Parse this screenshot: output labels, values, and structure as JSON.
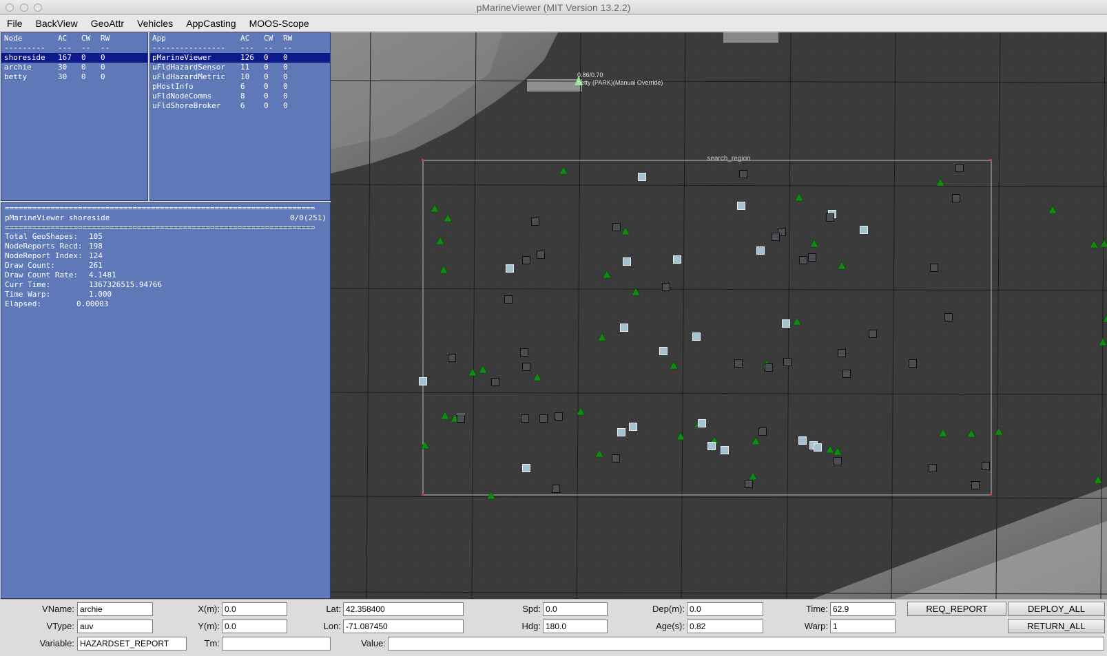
{
  "window": {
    "title": "pMarineViewer (MIT Version 13.2.2)"
  },
  "menu": [
    "File",
    "BackView",
    "GeoAttr",
    "Vehicles",
    "AppCasting",
    "MOOS-Scope"
  ],
  "nodes": {
    "headers": [
      "Node",
      "AC",
      "CW",
      "RW"
    ],
    "separator": [
      "---------",
      "---",
      "--",
      "--"
    ],
    "rows": [
      {
        "name": "shoreside",
        "ac": "167",
        "cw": "0",
        "rw": "0",
        "selected": true
      },
      {
        "name": "archie",
        "ac": "30",
        "cw": "0",
        "rw": "0"
      },
      {
        "name": "betty",
        "ac": "30",
        "cw": "0",
        "rw": "0"
      }
    ]
  },
  "apps": {
    "headers": [
      "App",
      "AC",
      "CW",
      "RW"
    ],
    "separator": [
      "----------------",
      "---",
      "--",
      "--"
    ],
    "rows": [
      {
        "name": "pMarineViewer",
        "ac": "126",
        "cw": "0",
        "rw": "0",
        "selected": true
      },
      {
        "name": "uFldHazardSensor",
        "ac": "11",
        "cw": "0",
        "rw": "0"
      },
      {
        "name": "uFldHazardMetric",
        "ac": "10",
        "cw": "0",
        "rw": "0"
      },
      {
        "name": "pHostInfo",
        "ac": "6",
        "cw": "0",
        "rw": "0"
      },
      {
        "name": "uFldNodeComms",
        "ac": "8",
        "cw": "0",
        "rw": "0"
      },
      {
        "name": "uFldShoreBroker",
        "ac": "6",
        "cw": "0",
        "rw": "0"
      }
    ]
  },
  "appcast": {
    "rule": "====================================================================",
    "header_left": "pMarineViewer shoreside",
    "header_right": "0/0(251)",
    "lines": [
      {
        "key": "Total GeoShapes:",
        "val": "105"
      },
      {
        "key": "NodeReports Recd:",
        "val": "198"
      },
      {
        "key": "NodeReport Index:",
        "val": "124"
      },
      {
        "key": "Draw Count:",
        "val": "261"
      },
      {
        "key": "Draw Count Rate:",
        "val": "4.1481"
      },
      {
        "key": "Curr Time:",
        "val": "1367326515.94766"
      },
      {
        "key": "Time Warp:",
        "val": "1.000"
      },
      {
        "key": "Elapsed:",
        "val": "0.00003"
      }
    ]
  },
  "map": {
    "region_label": "search_region",
    "vehicle_label_1": "0.86/0.70",
    "vehicle_label_2": "betty (PARK)(Manual Override)",
    "colors": {
      "triangle": "#138a13",
      "square_light": "#a4c2d0",
      "square_dark": "#4a4e52",
      "region": "#bdbdbd"
    }
  },
  "fields": {
    "vname": {
      "label": "VName:",
      "value": "archie"
    },
    "vtype": {
      "label": "VType:",
      "value": "auv"
    },
    "variable": {
      "label": "Variable:",
      "value": "HAZARDSET_REPORT"
    },
    "x": {
      "label": "X(m):",
      "value": "0.0"
    },
    "y": {
      "label": "Y(m):",
      "value": "0.0"
    },
    "tm": {
      "label": "Tm:",
      "value": ""
    },
    "lat": {
      "label": "Lat:",
      "value": "42.358400"
    },
    "lon": {
      "label": "Lon:",
      "value": "-71.087450"
    },
    "value": {
      "label": "Value:",
      "value": ""
    },
    "spd": {
      "label": "Spd:",
      "value": "0.0"
    },
    "hdg": {
      "label": "Hdg:",
      "value": "180.0"
    },
    "dep": {
      "label": "Dep(m):",
      "value": "0.0"
    },
    "age": {
      "label": "Age(s):",
      "value": "0.82"
    },
    "time": {
      "label": "Time:",
      "value": "62.9"
    },
    "warp": {
      "label": "Warp:",
      "value": "1"
    }
  },
  "buttons": {
    "req_report": "REQ_REPORT",
    "deploy_all": "DEPLOY_ALL",
    "return_all": "RETURN_ALL"
  }
}
